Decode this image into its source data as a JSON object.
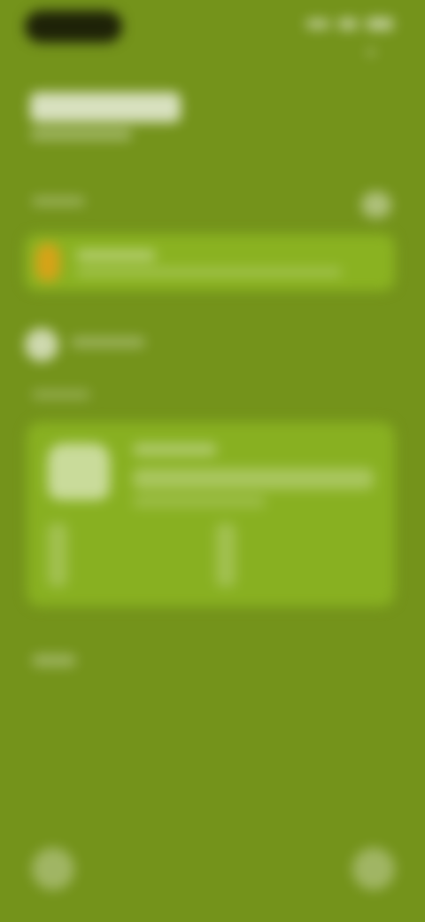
{
  "theme": {
    "background": "#74931b",
    "card": "#88b021",
    "alert_icon": "#d6a318"
  },
  "icons": {
    "battery": "battery-icon",
    "wifi": "wifi-icon",
    "signal": "signal-icon",
    "alert": "alert-icon",
    "avatar": "avatar-icon",
    "card": "card-icon",
    "left_button": "flashlight-icon",
    "right_button": "camera-icon"
  }
}
